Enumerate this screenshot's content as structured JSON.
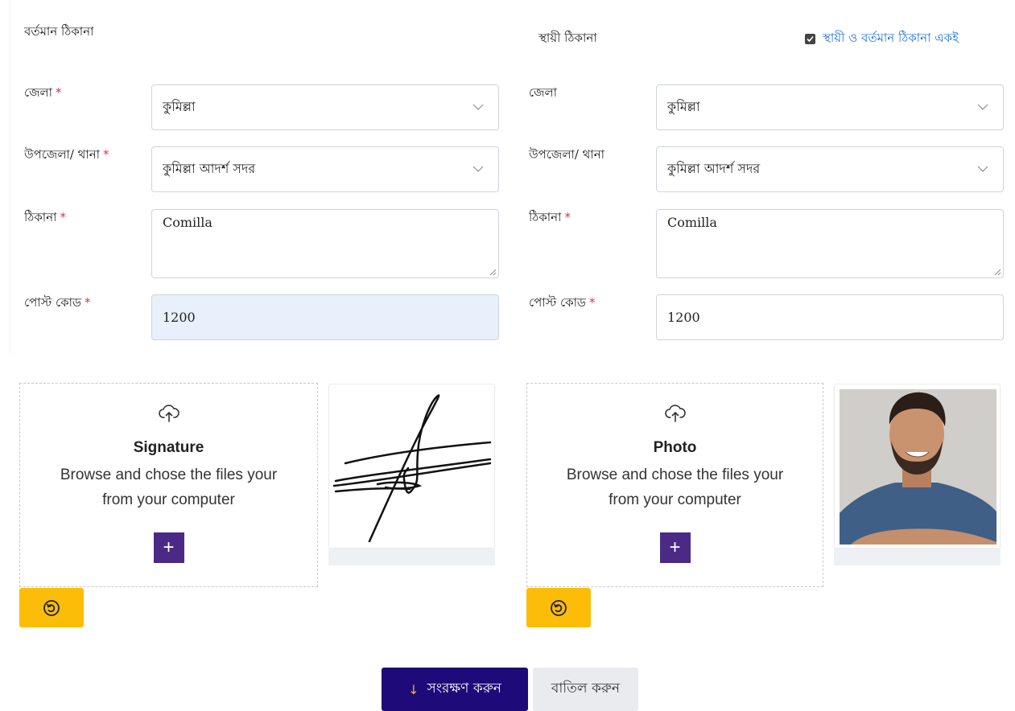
{
  "present_address": {
    "title": "বর্তমান ঠিকানা",
    "district_label": "জেলা",
    "district_value": "কুমিল্লা",
    "upazila_label": "উপজেলা/ থানা",
    "upazila_value": "কুমিল্লা আদর্শ সদর",
    "address_label": "ঠিকানা",
    "address_value": "Comilla",
    "postcode_label": "পোস্ট কোড",
    "postcode_value": "1200",
    "required_mark": "*"
  },
  "permanent_address": {
    "title": "স্থায়ী ঠিকানা",
    "same_checkbox_label": "স্থায়ী ও বর্তমান ঠিকানা একই",
    "same_checked": true,
    "district_label": "জেলা",
    "district_value": "কুমিল্লা",
    "upazila_label": "উপজেলা/ থানা",
    "upazila_value": "কুমিল্লা আদর্শ সদর",
    "address_label": "ঠিকানা",
    "address_value": "Comilla",
    "postcode_label": "পোস্ট কোড",
    "postcode_value": "1200",
    "required_mark": "*"
  },
  "uploads": {
    "signature": {
      "title": "Signature",
      "description": "Browse and chose the files your from your computer",
      "plus": "+"
    },
    "photo": {
      "title": "Photo",
      "description": "Browse and chose the files your from your computer",
      "plus": "+"
    }
  },
  "actions": {
    "save_arrow": "↓",
    "save_label": "সংরক্ষণ করুন",
    "cancel_label": "বাতিল করুন"
  },
  "colors": {
    "primary": "#1f0a7a",
    "upload_button": "#4b2a86",
    "rotate_button": "#fbbd08",
    "required": "#dc3545",
    "link": "#1e6fd9"
  }
}
